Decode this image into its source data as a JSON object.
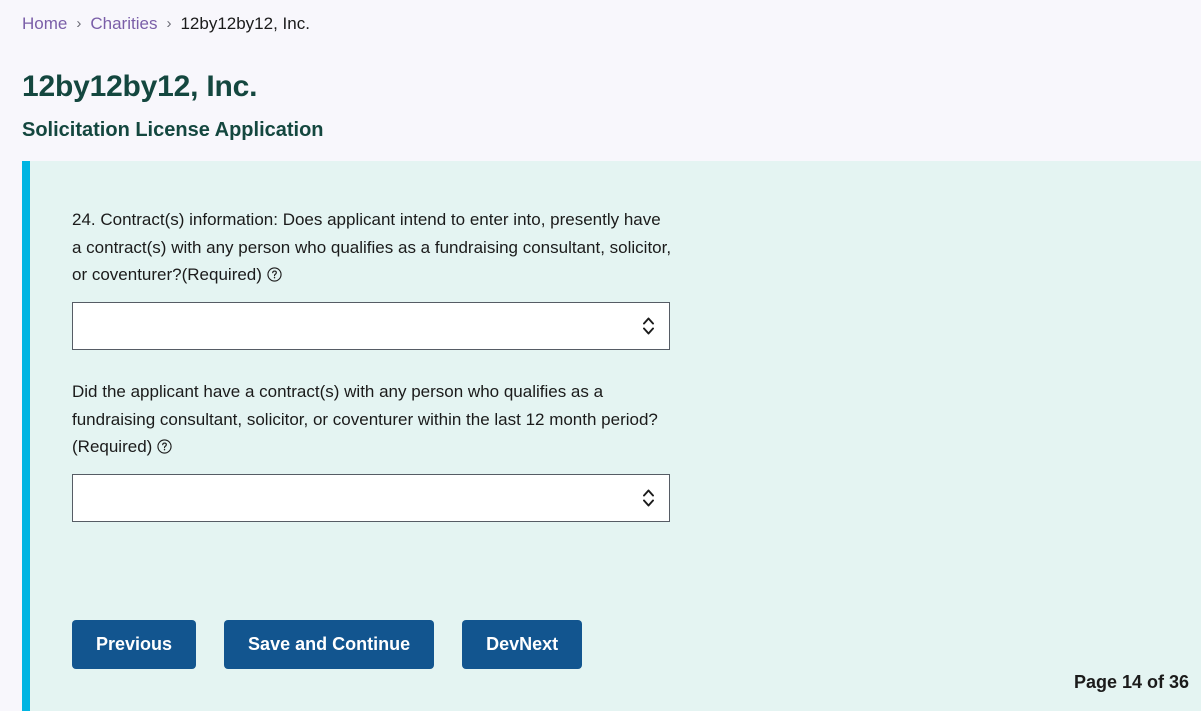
{
  "breadcrumb": {
    "separator": "›",
    "items": [
      {
        "label": "Home",
        "type": "link"
      },
      {
        "label": "Charities",
        "type": "link"
      },
      {
        "label": "12by12by12, Inc.",
        "type": "current"
      }
    ]
  },
  "header": {
    "org_title": "12by12by12, Inc.",
    "form_subtitle": "Solicitation License Application"
  },
  "form": {
    "fields": [
      {
        "number": "24.",
        "label": "24. Contract(s) information: Does applicant intend to enter into, presently have a contract(s) with any person who qualifies as a fundraising consultant, solicitor, or coventurer?(Required)",
        "help_icon": "question-circle-icon",
        "control": "select",
        "value": "",
        "options": [
          ""
        ]
      },
      {
        "number": "",
        "label": "Did the applicant have a contract(s) with any person who qualifies as a fundraising consultant, solicitor, or coventurer within the last 12 month period?(Required)",
        "help_icon": "question-circle-icon",
        "control": "select",
        "value": "",
        "options": [
          ""
        ]
      }
    ],
    "buttons": [
      {
        "label": "Previous",
        "name": "previous-button"
      },
      {
        "label": "Save and Continue",
        "name": "save-and-continue-button"
      },
      {
        "label": "DevNext",
        "name": "devnext-button"
      }
    ],
    "page_counter": "Page 14 of 36"
  },
  "colors": {
    "page_background": "#f8f7fc",
    "panel_background": "#e4f4f2",
    "panel_accent": "#00b5e2",
    "heading": "#14473f",
    "breadcrumb_link": "#7a5ea8",
    "button": "#12558f",
    "text": "#1b1b1b",
    "select_border": "#565c65"
  }
}
